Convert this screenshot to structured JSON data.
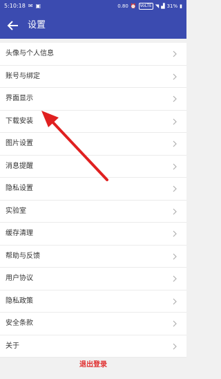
{
  "status_bar": {
    "time": "5:10:18",
    "left_icons": [
      "message-icon",
      "image-icon"
    ],
    "speed": "0.80",
    "network_badge": "VoLTE",
    "battery": "31%"
  },
  "header": {
    "back_icon": "arrow-left-icon",
    "title": "设置"
  },
  "settings": {
    "items": [
      {
        "label": "头像与个人信息"
      },
      {
        "label": "账号与绑定"
      },
      {
        "label": "界面显示"
      },
      {
        "label": "下载安装"
      },
      {
        "label": "图片设置"
      },
      {
        "label": "消息提醒"
      },
      {
        "label": "隐私设置"
      },
      {
        "label": "实验室"
      },
      {
        "label": "缓存清理"
      },
      {
        "label": "帮助与反馈"
      },
      {
        "label": "用户协议"
      },
      {
        "label": "隐私政策"
      },
      {
        "label": "安全条款"
      },
      {
        "label": "关于"
      }
    ],
    "chevron_icon": "chevron-right-icon"
  },
  "logout": {
    "label": "退出登录"
  },
  "colors": {
    "primary": "#3b4bb0",
    "background": "#f1f1f1",
    "logout_text": "#e02e2e",
    "annotation_arrow": "#e02020"
  }
}
